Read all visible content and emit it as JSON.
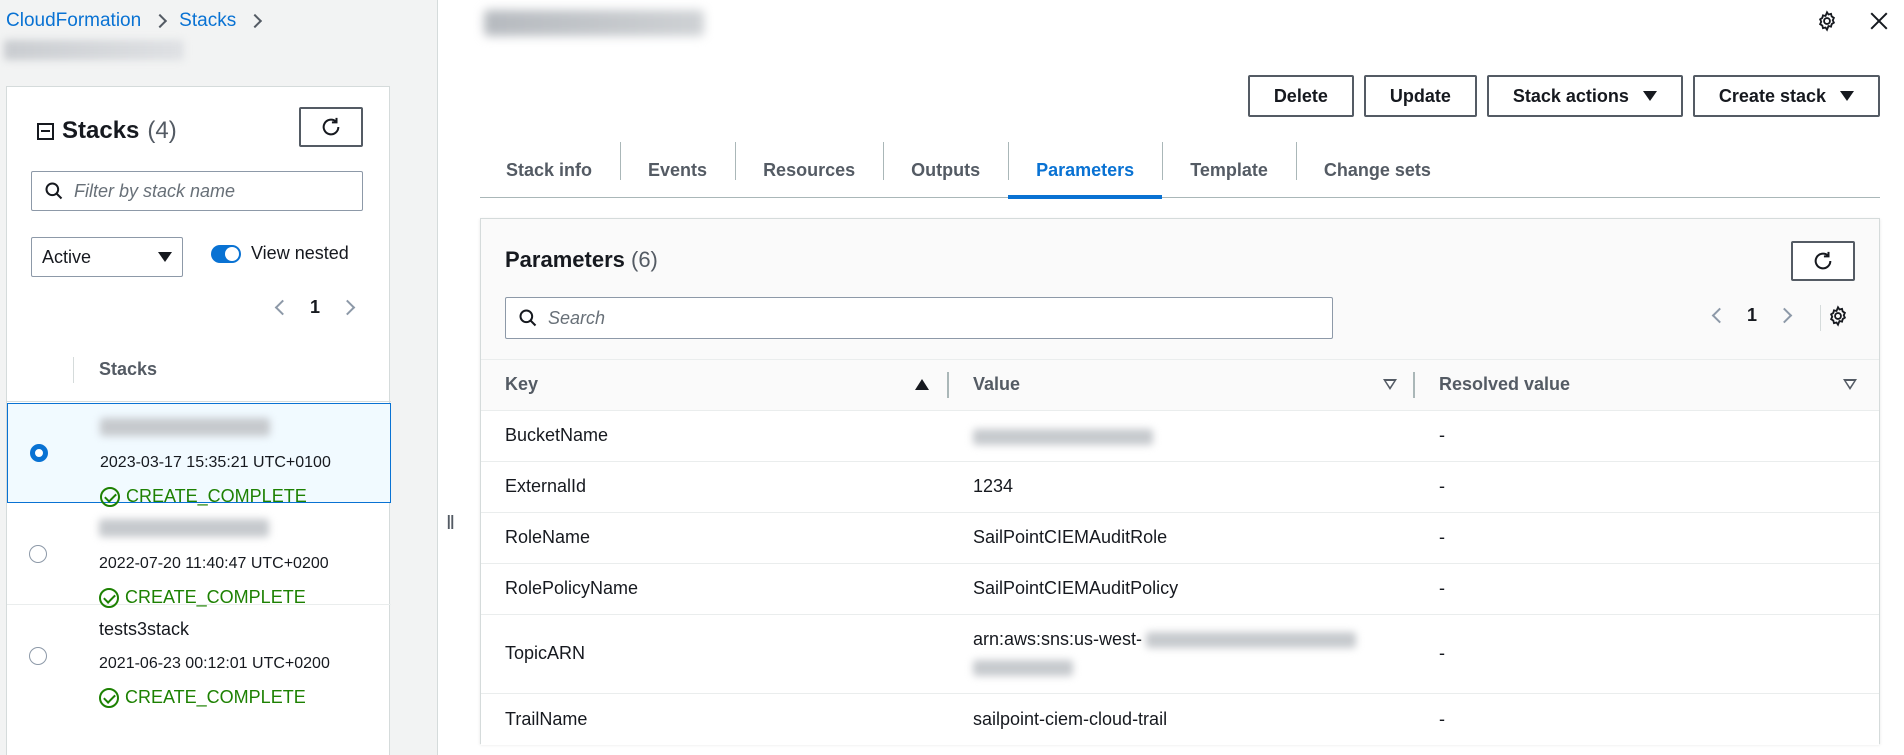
{
  "breadcrumb": {
    "items": [
      "CloudFormation",
      "Stacks"
    ]
  },
  "left": {
    "title": "Stacks",
    "count": "(4)",
    "filter_placeholder": "Filter by stack name",
    "status_filter": "Active",
    "view_nested_label": "View nested",
    "page": "1",
    "column_header": "Stacks",
    "stacks": [
      {
        "name": "",
        "date": "2023-03-17 15:35:21 UTC+0100",
        "status": "CREATE_COMPLETE",
        "selected": true
      },
      {
        "name": "",
        "date": "2022-07-20 11:40:47 UTC+0200",
        "status": "CREATE_COMPLETE",
        "selected": false
      },
      {
        "name": "tests3stack",
        "date": "2021-06-23 00:12:01 UTC+0200",
        "status": "CREATE_COMPLETE",
        "selected": false
      }
    ]
  },
  "resizer_glyph": "II",
  "toolbar": {
    "delete_label": "Delete",
    "update_label": "Update",
    "stack_actions_label": "Stack actions",
    "create_stack_label": "Create stack"
  },
  "tabs": [
    "Stack info",
    "Events",
    "Resources",
    "Outputs",
    "Parameters",
    "Template",
    "Change sets"
  ],
  "active_tab": "Parameters",
  "params": {
    "title": "Parameters",
    "count": "(6)",
    "search_placeholder": "Search",
    "page": "1",
    "columns": {
      "key": "Key",
      "value": "Value",
      "resolved": "Resolved value"
    },
    "rows": [
      {
        "key": "BucketName",
        "value": "",
        "resolved": "-"
      },
      {
        "key": "ExternalId",
        "value": "1234",
        "resolved": "-"
      },
      {
        "key": "RoleName",
        "value": "SailPointCIEMAuditRole",
        "resolved": "-"
      },
      {
        "key": "RolePolicyName",
        "value": "SailPointCIEMAuditPolicy",
        "resolved": "-"
      },
      {
        "key": "TopicARN",
        "value": "arn:aws:sns:us-west-",
        "resolved": "-"
      },
      {
        "key": "TrailName",
        "value": "sailpoint-ciem-cloud-trail",
        "resolved": "-"
      }
    ]
  },
  "colors": {
    "accent": "#0972d3",
    "success": "#1d8102",
    "text": "#16191f",
    "muted": "#545b64"
  }
}
